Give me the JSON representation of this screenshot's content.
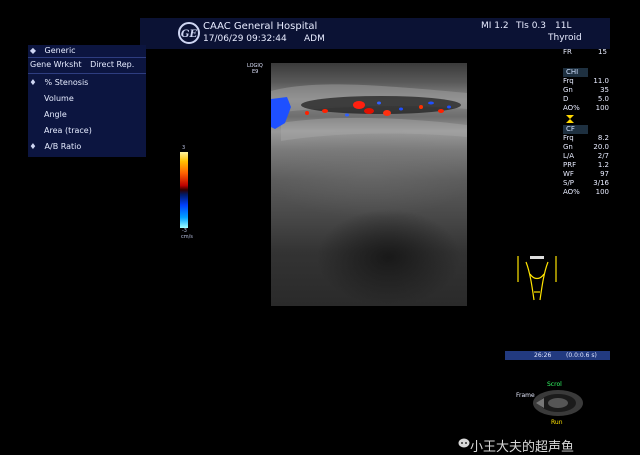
{
  "header": {
    "hospital": "CAAC General Hospital",
    "datetime": "17/06/29 09:32:44",
    "operator": "ADM",
    "logo_text": "GE",
    "mi": "MI 1.2",
    "tis": "TIs 0.3",
    "probe": "11L",
    "preset": "Thyroid"
  },
  "menu": {
    "title": "Generic",
    "tabs": [
      "Gene Wrksht",
      "Direct Rep."
    ],
    "items": [
      {
        "label": "% Stenosis",
        "bullet": true
      },
      {
        "label": "Volume",
        "bullet": false
      },
      {
        "label": "Angle",
        "bullet": false
      },
      {
        "label": "Area (trace)",
        "bullet": false
      },
      {
        "label": "A/B Ratio",
        "bullet": true
      }
    ]
  },
  "color_scale": {
    "top": "3",
    "bottom": "-3",
    "unit": "cm/s"
  },
  "image": {
    "probe_label_line1": "LOGIQ",
    "probe_label_line2": "E9"
  },
  "right_panel": {
    "fr_key": "FR",
    "fr_val": "15",
    "chi": {
      "head": "CHI",
      "rows": [
        [
          "Frq",
          "11.0"
        ],
        [
          "Gn",
          "35"
        ],
        [
          "D",
          "5.0"
        ],
        [
          "AO%",
          "100"
        ]
      ]
    },
    "cf": {
      "head": "CF",
      "rows": [
        [
          "Frq",
          "8.2"
        ],
        [
          "Gn",
          "20.0"
        ],
        [
          "L/A",
          "2/7"
        ],
        [
          "PRF",
          "1.2"
        ],
        [
          "WF",
          "97"
        ],
        [
          "S/P",
          "3/16"
        ],
        [
          "AO%",
          "100"
        ]
      ]
    }
  },
  "cine": {
    "frame": "26:26",
    "time": "(0.0:0.6 s)"
  },
  "controls": {
    "scroll": "Scrol",
    "frame": "Frame",
    "run": "Run"
  },
  "watermark": "小王大夫的超声鱼",
  "colors": {
    "accent_blue": "#0c1540",
    "scale_red": "#ff2000",
    "scale_blue": "#0040ff",
    "trackball_green": "#33ff66"
  }
}
